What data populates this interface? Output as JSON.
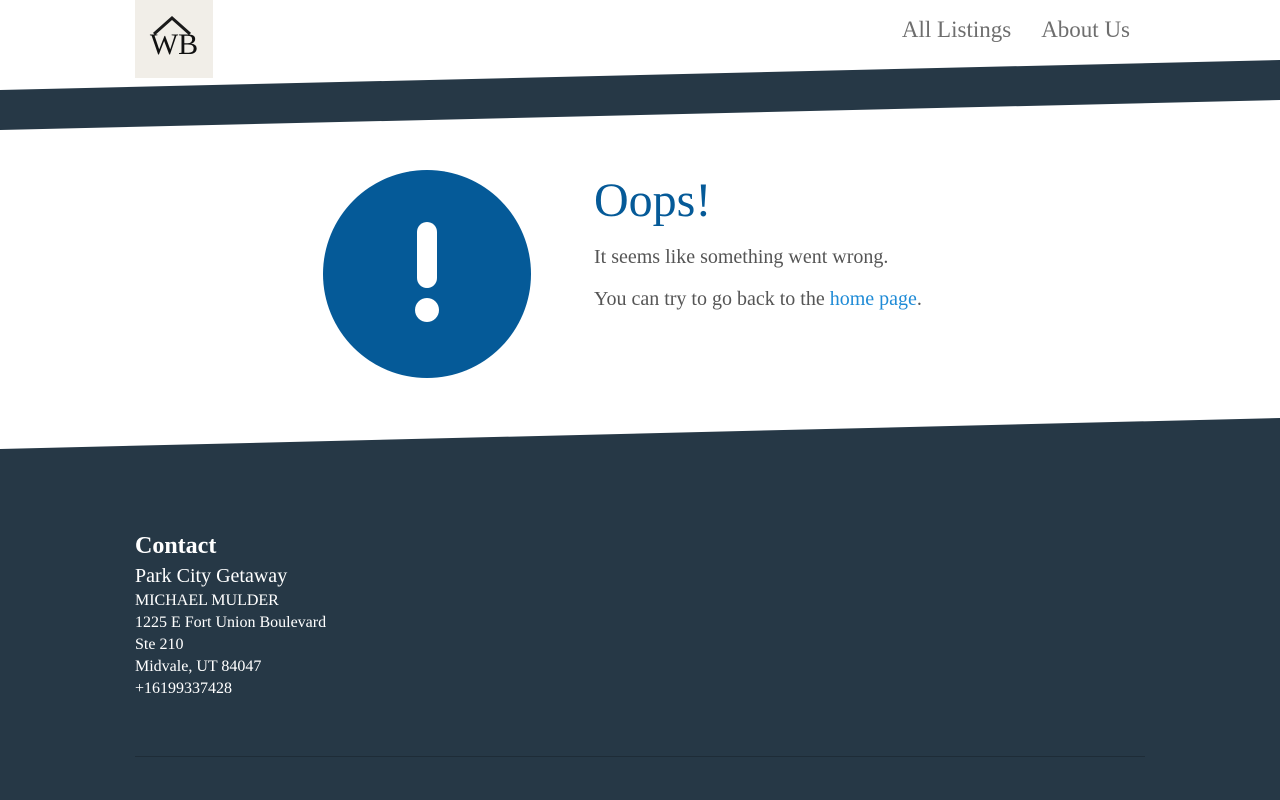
{
  "header": {
    "logo_text": "WB",
    "nav": [
      {
        "label": "All Listings"
      },
      {
        "label": "About Us"
      }
    ]
  },
  "error": {
    "icon": "exclamation-circle-icon",
    "title": "Oops!",
    "message": "It seems like something went wrong.",
    "back_prefix": "You can try to go back to the ",
    "back_link": "home page",
    "back_suffix": "."
  },
  "footer": {
    "heading": "Contact",
    "business": "Park City Getaway",
    "name": "MICHAEL MULDER",
    "address1": "1225 E Fort Union Boulevard",
    "address2": "Ste 210",
    "city": "Midvale, UT 84047",
    "phone": "+16199337428"
  },
  "colors": {
    "navy": "#263846",
    "accent_blue": "#055a98",
    "link_blue": "#1f8bd6",
    "logo_bg": "#f1eee8"
  }
}
